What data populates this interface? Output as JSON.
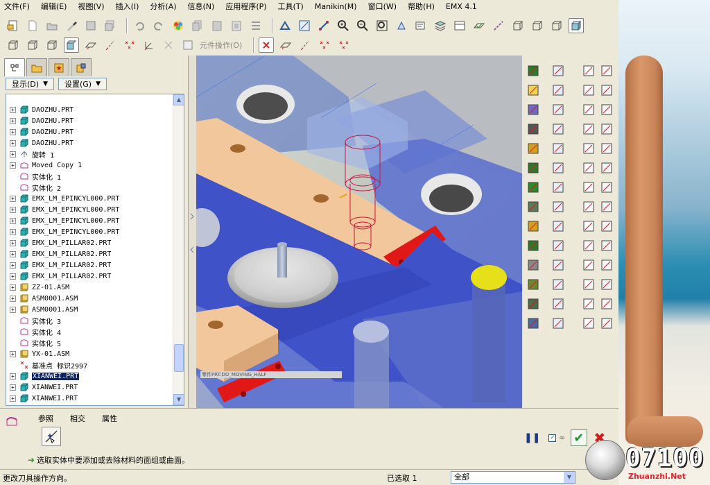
{
  "menubar": {
    "items": [
      "文件(F)",
      "编辑(E)",
      "视图(V)",
      "插入(I)",
      "分析(A)",
      "信息(N)",
      "应用程序(P)",
      "工具(T)",
      "Manikin(M)",
      "窗口(W)",
      "帮助(H)",
      "EMX 4.1"
    ]
  },
  "toolbar2": {
    "component_op_label": "元件操作(O)"
  },
  "left_panel": {
    "show_label": "显示(D)",
    "settings_label": "设置(G)"
  },
  "tree": {
    "items": [
      {
        "label": "DAOZHU.PRT",
        "icon": "part-icon",
        "expand": "+"
      },
      {
        "label": "DAOZHU.PRT",
        "icon": "part-icon",
        "expand": "+"
      },
      {
        "label": "DAOZHU.PRT",
        "icon": "part-icon",
        "expand": "+"
      },
      {
        "label": "DAOZHU.PRT",
        "icon": "part-icon",
        "expand": "+"
      },
      {
        "label": "旋转 1",
        "icon": "revolve-icon",
        "expand": "+"
      },
      {
        "label": "Moved Copy 1",
        "icon": "copy-icon",
        "expand": "+"
      },
      {
        "label": "实体化 1",
        "icon": "solidify-icon",
        "expand": ""
      },
      {
        "label": "实体化 2",
        "icon": "solidify-icon",
        "expand": ""
      },
      {
        "label": "EMX_LM_EPINCYL000.PRT",
        "icon": "part-icon",
        "expand": "+"
      },
      {
        "label": "EMX_LM_EPINCYL000.PRT",
        "icon": "part-icon",
        "expand": "+"
      },
      {
        "label": "EMX_LM_EPINCYL000.PRT",
        "icon": "part-icon",
        "expand": "+"
      },
      {
        "label": "EMX_LM_EPINCYL000.PRT",
        "icon": "part-icon",
        "expand": "+"
      },
      {
        "label": "EMX_LM_PILLAR02.PRT",
        "icon": "part-icon",
        "expand": "+"
      },
      {
        "label": "EMX_LM_PILLAR02.PRT",
        "icon": "part-icon",
        "expand": "+"
      },
      {
        "label": "EMX_LM_PILLAR02.PRT",
        "icon": "part-icon",
        "expand": "+"
      },
      {
        "label": "EMX_LM_PILLAR02.PRT",
        "icon": "part-icon",
        "expand": "+"
      },
      {
        "label": "ZZ-01.ASM",
        "icon": "assembly-icon",
        "expand": "+"
      },
      {
        "label": "ASM0001.ASM",
        "icon": "assembly-icon",
        "expand": "+"
      },
      {
        "label": "ASM0001.ASM",
        "icon": "assembly-icon",
        "expand": "+"
      },
      {
        "label": "实体化 3",
        "icon": "solidify-icon",
        "expand": ""
      },
      {
        "label": "实体化 4",
        "icon": "solidify-icon",
        "expand": ""
      },
      {
        "label": "实体化 5",
        "icon": "solidify-icon",
        "expand": ""
      },
      {
        "label": "YX-01.ASM",
        "icon": "assembly-icon",
        "expand": "+"
      },
      {
        "label": "基准点 标识2997",
        "icon": "datum-point-icon",
        "expand": ""
      },
      {
        "label": "XIANWEI.PRT",
        "icon": "part-icon",
        "expand": "+",
        "selected": true
      },
      {
        "label": "XIANWEI.PRT",
        "icon": "part-icon",
        "expand": "+"
      },
      {
        "label": "XIANWEI.PRT",
        "icon": "part-icon",
        "expand": "+"
      }
    ]
  },
  "viewport": {
    "message": "零件PRT:DO_MOVING_HALF"
  },
  "dashboard": {
    "tabs": [
      "参照",
      "相交",
      "属性"
    ],
    "prompt": "选取实体中要添加或去除材料的面组或曲面。"
  },
  "statusbar": {
    "message": "更改刀具操作方向。",
    "selected": "已选取 1",
    "filter": "全部"
  },
  "watermark": {
    "number": "07100",
    "site": "Zhuanzhi.Net"
  },
  "colors": {
    "accent": "#0a246a",
    "mold_blue": "#3f52c8",
    "plate_orange": "#f2c79b",
    "highlight_red": "#e01818",
    "yellow_pin": "#e6e01a"
  }
}
